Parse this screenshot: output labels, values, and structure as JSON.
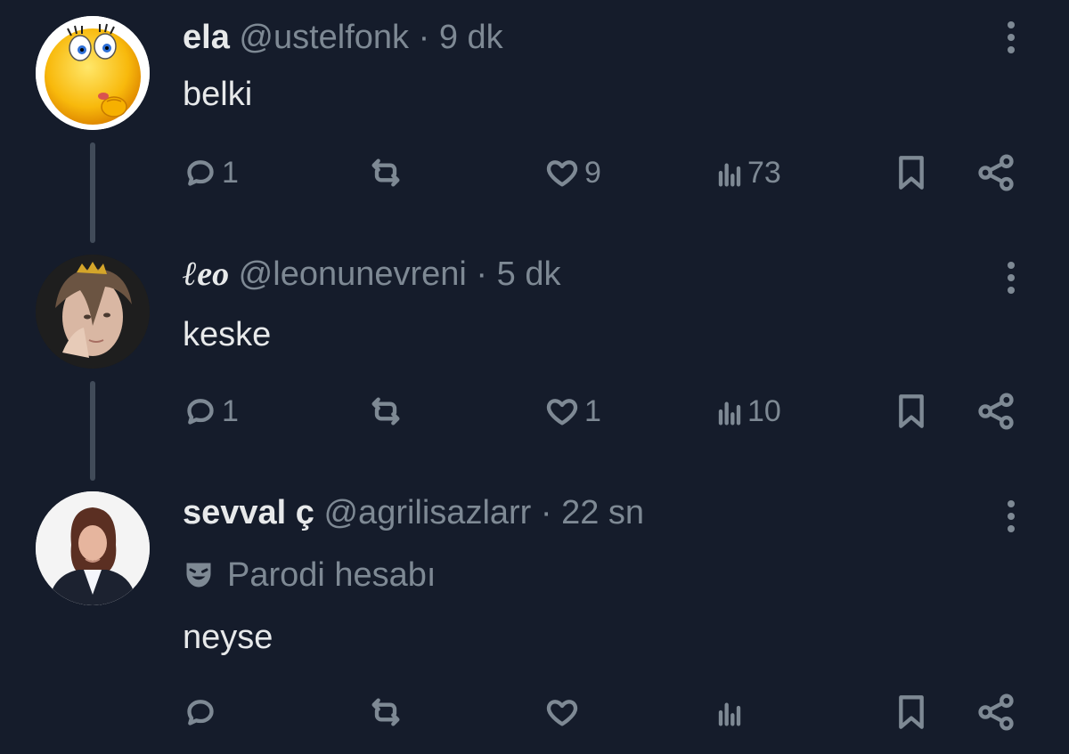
{
  "tweets": [
    {
      "name": "ela",
      "handle": "@ustelfonk",
      "separator": "·",
      "time": "9 dk",
      "text": "belki",
      "avatar_icon": "winking-smiley-emoji",
      "actions": {
        "replies": "1",
        "retweets": "",
        "likes": "9",
        "views": "73"
      }
    },
    {
      "name": "ℓeo",
      "handle": "@leonunevreni",
      "separator": "·",
      "time": "5 dk",
      "text": "keske",
      "avatar_icon": "person-photo",
      "actions": {
        "replies": "1",
        "retweets": "",
        "likes": "1",
        "views": "10"
      }
    },
    {
      "name": "sevval ç",
      "handle": "@agrilisazlarr",
      "separator": "·",
      "time": "22 sn",
      "badge": "Parodi hesabı",
      "badge_icon": "theater-mask-icon",
      "text": "neyse",
      "avatar_icon": "person-photo",
      "actions": {
        "replies": "",
        "retweets": "",
        "likes": "",
        "views": ""
      }
    }
  ],
  "colors": {
    "background": "#151c2b",
    "text_primary": "#e7e9ea",
    "text_secondary": "#7e8994",
    "thread_line": "#414b59"
  }
}
